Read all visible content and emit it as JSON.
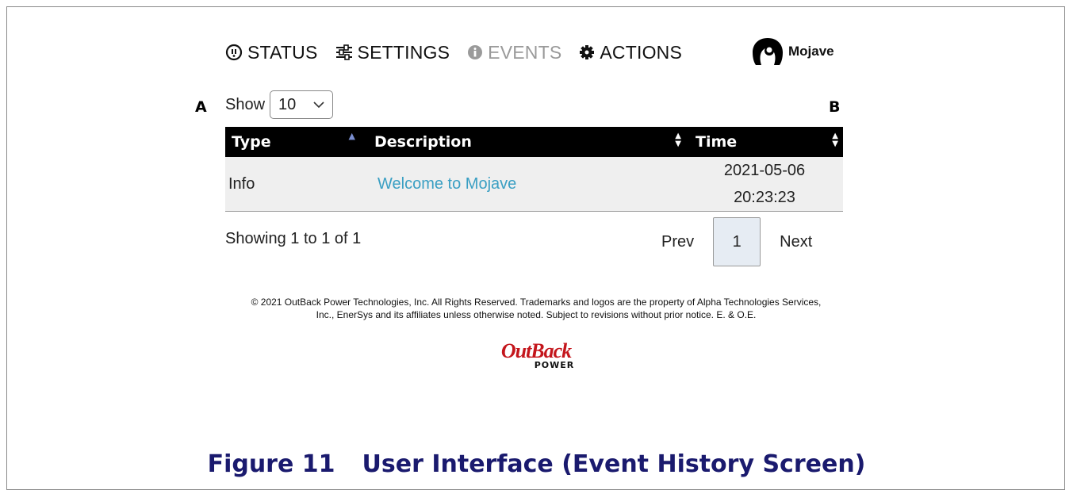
{
  "nav": {
    "items": [
      {
        "label": "STATUS",
        "icon": "status-icon"
      },
      {
        "label": "SETTINGS",
        "icon": "sliders-icon"
      },
      {
        "label": "EVENTS",
        "icon": "info-icon"
      },
      {
        "label": "ACTIONS",
        "icon": "gear-icon"
      }
    ],
    "user": "Mojave"
  },
  "callouts": {
    "a": "A",
    "b": "B"
  },
  "show": {
    "label": "Show",
    "value": "10"
  },
  "table": {
    "headers": [
      "Type",
      "Description",
      "Time"
    ],
    "rows": [
      {
        "type": "Info",
        "description": "Welcome to Mojave",
        "time_date": "2021-05-06",
        "time_clock": "20:23:23"
      }
    ]
  },
  "pagination": {
    "info": "Showing 1 to 1 of 1",
    "prev": "Prev",
    "page": "1",
    "next": "Next"
  },
  "footer": {
    "legal": "© 2021 OutBack Power Technologies, Inc. All Rights Reserved. Trademarks and logos are the property of Alpha Technologies Services, Inc., EnerSys and its affiliates unless otherwise noted. Subject to revisions without prior notice. E. & O.E.",
    "logo_top": "OutBack",
    "logo_bottom": "POWER"
  },
  "caption": {
    "number": "Figure 11",
    "text": "User Interface (Event History Screen)"
  },
  "colors": {
    "link": "#3a9fc3",
    "caption": "#1a1a6e",
    "logo_red": "#c4161c",
    "header_bg": "#000000"
  }
}
